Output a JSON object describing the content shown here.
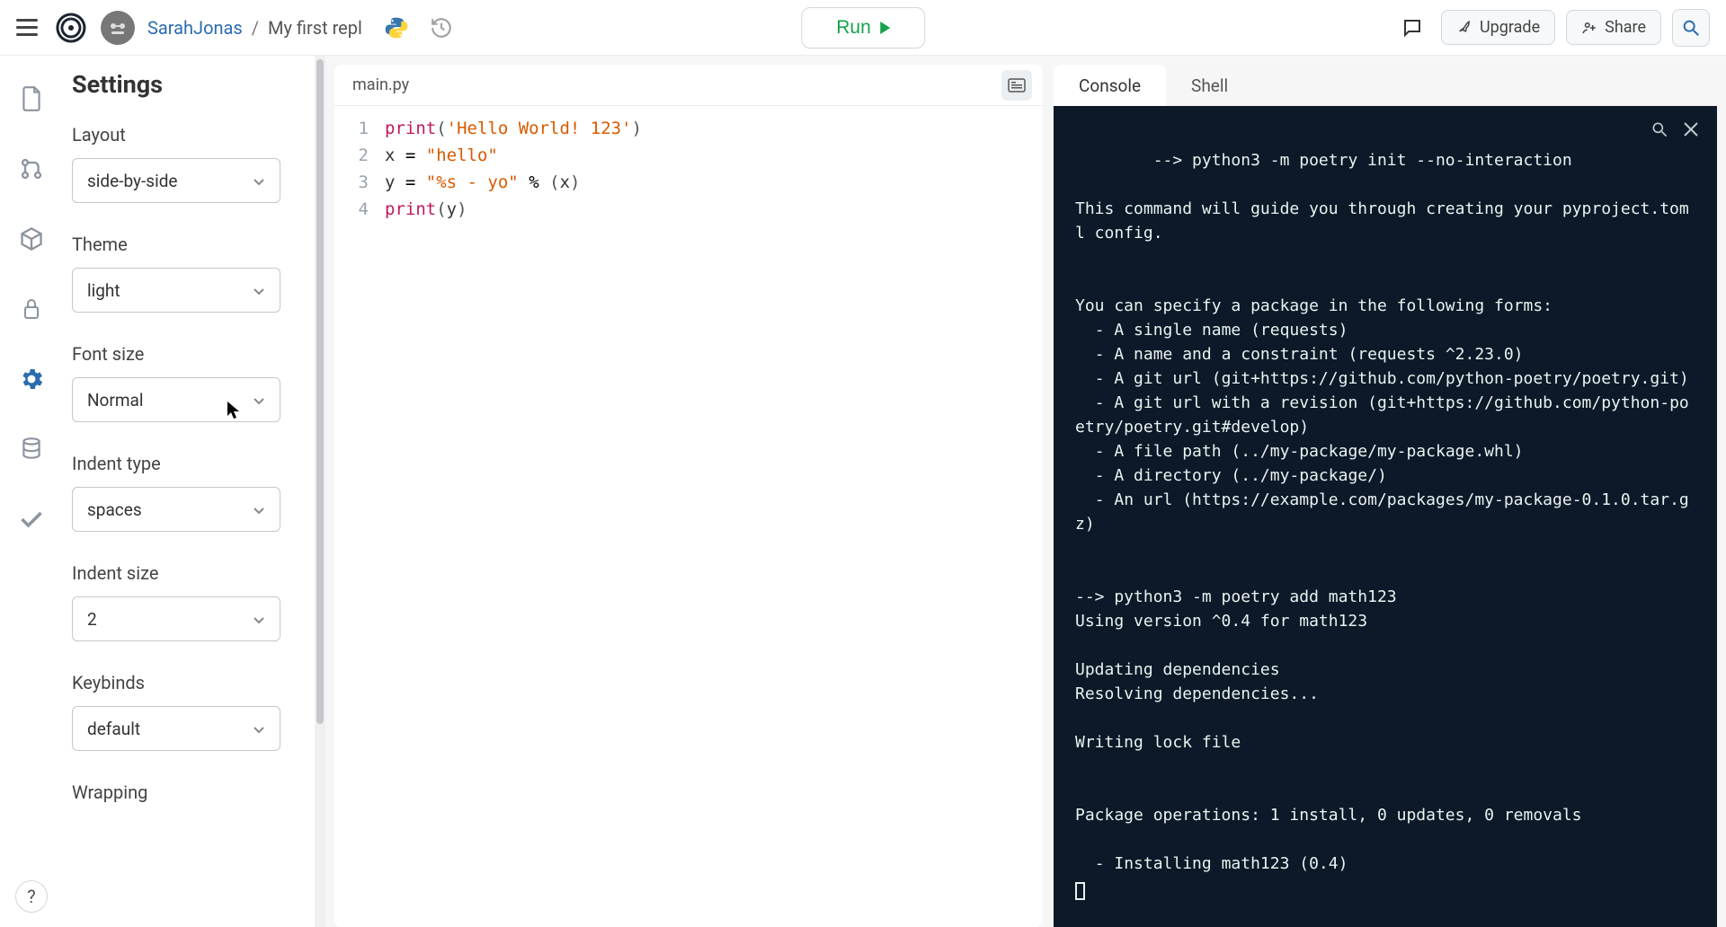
{
  "header": {
    "user": "SarahJonas",
    "separator": "/",
    "repl_name": "My first repl",
    "run_label": "Run",
    "upgrade_label": "Upgrade",
    "share_label": "Share"
  },
  "sidebar_icons": [
    "file",
    "version-control",
    "package",
    "lock",
    "settings",
    "database",
    "check"
  ],
  "settings": {
    "title": "Settings",
    "groups": [
      {
        "label": "Layout",
        "value": "side-by-side"
      },
      {
        "label": "Theme",
        "value": "light"
      },
      {
        "label": "Font size",
        "value": "Normal"
      },
      {
        "label": "Indent type",
        "value": "spaces"
      },
      {
        "label": "Indent size",
        "value": "2"
      },
      {
        "label": "Keybinds",
        "value": "default"
      },
      {
        "label": "Wrapping",
        "value": ""
      }
    ]
  },
  "editor": {
    "tab": "main.py",
    "lines": [
      {
        "n": "1",
        "html": "<span class='fn'>print</span><span class='p'>(</span><span class='s'>'Hello World! 123'</span><span class='p'>)</span>"
      },
      {
        "n": "2",
        "html": "<span class='v'>x </span>=<span class='v'> </span><span class='s'>\"hello\"</span>"
      },
      {
        "n": "3",
        "html": "<span class='v'>y </span>=<span class='v'> </span><span class='s'>\"%s - yo\"</span><span class='v'> </span>%<span class='v'> </span><span class='p'>(</span><span class='v'>x</span><span class='p'>)</span>"
      },
      {
        "n": "4",
        "html": "<span class='fn'>print</span><span class='p'>(</span><span class='v'>y</span><span class='p'>)</span>"
      }
    ]
  },
  "console": {
    "tabs": {
      "console": "Console",
      "shell": "Shell"
    },
    "text": "--> python3 -m poetry init --no-interaction\n\nThis command will guide you through creating your pyproject.toml config.\n\n\nYou can specify a package in the following forms:\n  - A single name (requests)\n  - A name and a constraint (requests ^2.23.0)\n  - A git url (git+https://github.com/python-poetry/poetry.git)\n  - A git url with a revision (git+https://github.com/python-poetry/poetry.git#develop)\n  - A file path (../my-package/my-package.whl)\n  - A directory (../my-package/)\n  - An url (https://example.com/packages/my-package-0.1.0.tar.gz)\n\n\n--> python3 -m poetry add math123\nUsing version ^0.4 for math123\n\nUpdating dependencies\nResolving dependencies...\n\nWriting lock file\n\n\nPackage operations: 1 install, 0 updates, 0 removals\n\n  - Installing math123 (0.4)"
  },
  "help_label": "?"
}
